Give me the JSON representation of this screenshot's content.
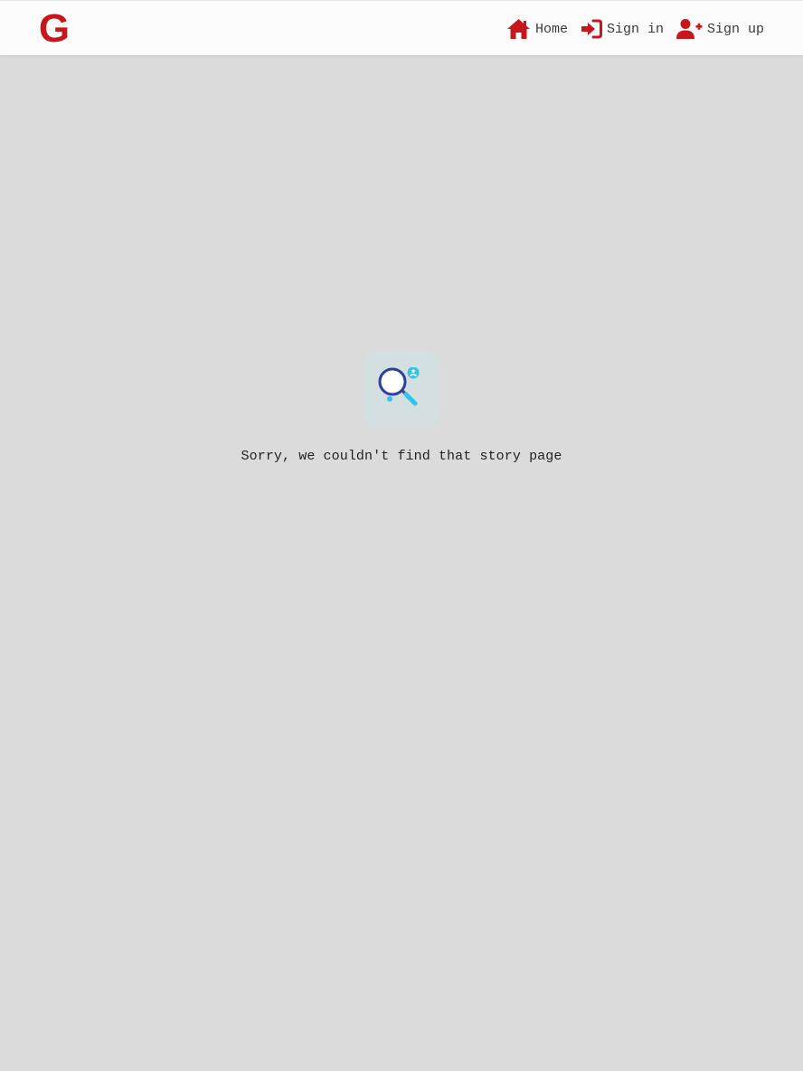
{
  "header": {
    "logo_text": "G",
    "brand_color": "#c8161d",
    "nav": [
      {
        "label": "Home",
        "icon": "home-icon"
      },
      {
        "label": "Sign in",
        "icon": "sign-in-icon"
      },
      {
        "label": "Sign up",
        "icon": "user-plus-icon"
      }
    ]
  },
  "main": {
    "illustration_icon": "magnifier-search-icon",
    "message": "Sorry, we couldn't find that story page"
  }
}
